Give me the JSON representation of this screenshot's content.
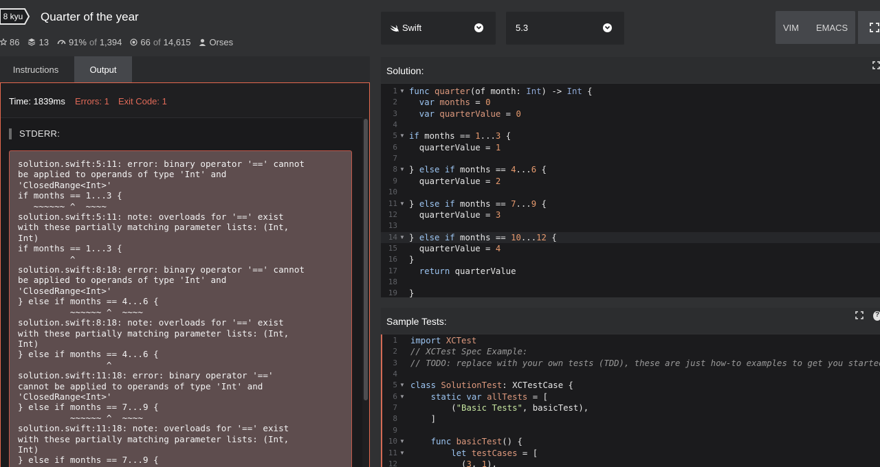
{
  "header": {
    "rank": "8 kyu",
    "title": "Quarter of the year",
    "stats": {
      "stars": "86",
      "collections": "13",
      "satisfaction": "91%",
      "satisfaction_of": "of",
      "satisfaction_total": "1,394",
      "completed": "66",
      "completed_of": "of",
      "completed_total": "14,615",
      "author": "Orses"
    }
  },
  "toolbar": {
    "language": "Swift",
    "version": "5.3",
    "modes": [
      "VIM",
      "EMACS"
    ]
  },
  "tabs": [
    "Instructions",
    "Output"
  ],
  "output": {
    "time": "Time: 1839ms",
    "errors": "Errors: 1",
    "exit_code": "Exit Code: 1",
    "stderr_title": "STDERR:",
    "stderr_lines": [
      "solution.swift:5:11: error: binary operator '==' cannot",
      "be applied to operands of type 'Int' and",
      "'ClosedRange<Int>'",
      "if months == 1...3 {",
      "   ~~~~~~ ^  ~~~~",
      "solution.swift:5:11: note: overloads for '==' exist",
      "with these partially matching parameter lists: (Int,",
      "Int)",
      "if months == 1...3 {",
      "          ^",
      "solution.swift:8:18: error: binary operator '==' cannot",
      "be applied to operands of type 'Int' and",
      "'ClosedRange<Int>'",
      "} else if months == 4...6 {",
      "          ~~~~~~ ^  ~~~~",
      "solution.swift:8:18: note: overloads for '==' exist",
      "with these partially matching parameter lists: (Int,",
      "Int)",
      "} else if months == 4...6 {",
      "                 ^",
      "solution.swift:11:18: error: binary operator '=='",
      "cannot be applied to operands of type 'Int' and",
      "'ClosedRange<Int>'",
      "} else if months == 7...9 {",
      "          ~~~~~~ ^  ~~~~",
      "solution.swift:11:18: note: overloads for '==' exist",
      "with these partially matching parameter lists: (Int,",
      "Int)",
      "} else if months == 7...9 {"
    ]
  },
  "solution": {
    "title": "Solution:",
    "lines": [
      [
        {
          "t": "func ",
          "c": "k"
        },
        {
          "t": "quarter",
          "c": "f"
        },
        {
          "t": "(of month: "
        },
        {
          "t": "Int",
          "c": "t"
        },
        {
          "t": ") -> "
        },
        {
          "t": "Int",
          "c": "t"
        },
        {
          "t": " {"
        }
      ],
      [
        {
          "t": "  var ",
          "c": "k"
        },
        {
          "t": "months",
          "c": "f"
        },
        {
          "t": " = "
        },
        {
          "t": "0",
          "c": "n"
        }
      ],
      [
        {
          "t": "  var ",
          "c": "k"
        },
        {
          "t": "quarterValue",
          "c": "f"
        },
        {
          "t": " = "
        },
        {
          "t": "0",
          "c": "n"
        }
      ],
      [],
      [
        {
          "t": "if ",
          "c": "k"
        },
        {
          "t": "months == "
        },
        {
          "t": "1",
          "c": "n"
        },
        {
          "t": "..."
        },
        {
          "t": "3",
          "c": "n"
        },
        {
          "t": " {"
        }
      ],
      [
        {
          "t": "  quarterValue = "
        },
        {
          "t": "1",
          "c": "n"
        }
      ],
      [],
      [
        {
          "t": "} "
        },
        {
          "t": "else if ",
          "c": "k"
        },
        {
          "t": "months == "
        },
        {
          "t": "4",
          "c": "n"
        },
        {
          "t": "..."
        },
        {
          "t": "6",
          "c": "n"
        },
        {
          "t": " {"
        }
      ],
      [
        {
          "t": "  quarterValue = "
        },
        {
          "t": "2",
          "c": "n"
        }
      ],
      [],
      [
        {
          "t": "} "
        },
        {
          "t": "else if ",
          "c": "k"
        },
        {
          "t": "months == "
        },
        {
          "t": "7",
          "c": "n"
        },
        {
          "t": "..."
        },
        {
          "t": "9",
          "c": "n"
        },
        {
          "t": " {"
        }
      ],
      [
        {
          "t": "  quarterValue = "
        },
        {
          "t": "3",
          "c": "n"
        }
      ],
      [],
      [
        {
          "t": "} "
        },
        {
          "t": "else if ",
          "c": "k"
        },
        {
          "t": "months == "
        },
        {
          "t": "10",
          "c": "n"
        },
        {
          "t": "..."
        },
        {
          "t": "12",
          "c": "n"
        },
        {
          "t": " {"
        }
      ],
      [
        {
          "t": "  quarterValue = "
        },
        {
          "t": "4",
          "c": "n"
        }
      ],
      [
        {
          "t": "}"
        }
      ],
      [
        {
          "t": "  return ",
          "c": "k"
        },
        {
          "t": "quarterValue"
        }
      ],
      [],
      [
        {
          "t": "}"
        }
      ]
    ],
    "fold_lines": [
      1,
      5,
      8,
      11,
      14
    ],
    "active_line": 14
  },
  "tests": {
    "title": "Sample Tests:",
    "lines": [
      [
        {
          "t": "import ",
          "c": "k"
        },
        {
          "t": "XCTest",
          "c": "f"
        }
      ],
      [
        {
          "t": "// XCTest Spec Example:",
          "c": "c"
        }
      ],
      [
        {
          "t": "// TODO: replace with your own tests (TDD), these are just how-to examples to get you started",
          "c": "c"
        }
      ],
      [],
      [
        {
          "t": "class ",
          "c": "k"
        },
        {
          "t": "SolutionTest",
          "c": "f"
        },
        {
          "t": ": XCTestCase {"
        }
      ],
      [
        {
          "t": "    static var ",
          "c": "k"
        },
        {
          "t": "allTests",
          "c": "f"
        },
        {
          "t": " = ["
        }
      ],
      [
        {
          "t": "        ("
        },
        {
          "t": "\"Basic Tests\"",
          "c": "s"
        },
        {
          "t": ", basicTest),"
        }
      ],
      [
        {
          "t": "    ]"
        }
      ],
      [],
      [
        {
          "t": "    func ",
          "c": "k"
        },
        {
          "t": "basicTest",
          "c": "f"
        },
        {
          "t": "() {"
        }
      ],
      [
        {
          "t": "        let ",
          "c": "k"
        },
        {
          "t": "testCases",
          "c": "f"
        },
        {
          "t": " = ["
        }
      ],
      [
        {
          "t": "          ("
        },
        {
          "t": "3",
          "c": "n"
        },
        {
          "t": ", "
        },
        {
          "t": "1",
          "c": "n"
        },
        {
          "t": "),"
        }
      ]
    ],
    "fold_lines": [
      5,
      6,
      10,
      11
    ]
  }
}
